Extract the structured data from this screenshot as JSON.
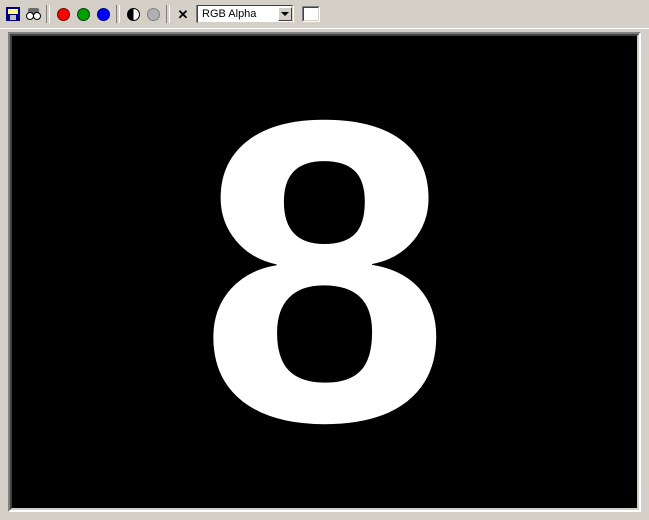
{
  "toolbar": {
    "channel_mode": {
      "selected": "RGB Alpha"
    }
  },
  "viewport": {
    "content": "8",
    "background_color": "#000000",
    "foreground_color": "#ffffff"
  },
  "color_swatch": "#ffffff"
}
